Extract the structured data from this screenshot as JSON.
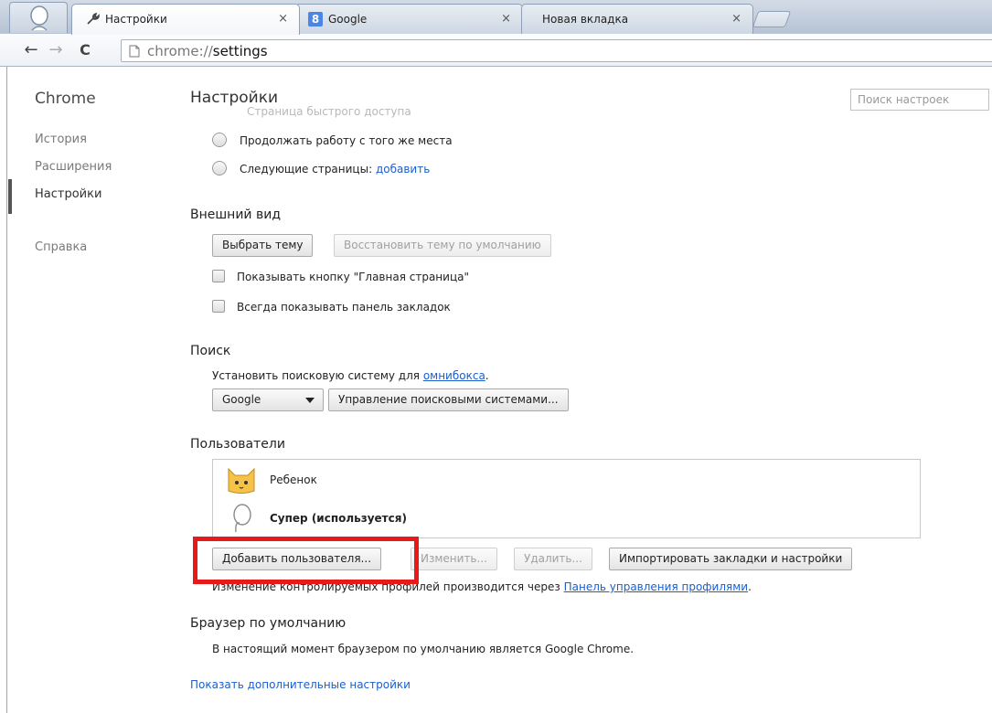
{
  "tabs": [
    {
      "title": "Настройки",
      "icon": "wrench-icon",
      "close": "×"
    },
    {
      "title": "Google",
      "icon": "google-icon",
      "icon_glyph": "8",
      "close": "×"
    },
    {
      "title": "Новая вкладка",
      "icon": "",
      "close": "×"
    }
  ],
  "toolbar": {
    "back": "←",
    "forward": "→",
    "reload": "C",
    "url_scheme": "chrome://",
    "url_host": "settings"
  },
  "sidebar": {
    "title": "Chrome",
    "items": [
      {
        "label": "История"
      },
      {
        "label": "Расширения"
      },
      {
        "label": "Настройки"
      },
      {
        "label": "Справка"
      }
    ]
  },
  "main": {
    "title": "Настройки",
    "ghost_text": "Страница быстрого доступа",
    "search_placeholder": "Поиск настроек",
    "startup": {
      "option1": "Продолжать работу с того же места",
      "option2": "Следующие страницы:",
      "option2_link": "добавить"
    },
    "appearance": {
      "title": "Внешний вид",
      "choose_theme": "Выбрать тему",
      "reset_theme": "Восстановить тему по умолчанию",
      "show_home": "Показывать кнопку \"Главная страница\"",
      "show_bookmarks": "Всегда показывать панель закладок"
    },
    "search": {
      "title": "Поиск",
      "description": "Установить поисковую систему для",
      "description_link": "омнибокса",
      "description_end": ".",
      "engine": "Google",
      "manage": "Управление поисковыми системами..."
    },
    "users": {
      "title": "Пользователи",
      "list": [
        {
          "name": "Ребенок",
          "avatar": "cat-avatar-icon"
        },
        {
          "name": "Супер (используется)",
          "avatar": "default-avatar-icon"
        }
      ],
      "add": "Добавить пользователя...",
      "edit": "Изменить...",
      "delete": "Удалить...",
      "import": "Импортировать закладки и настройки",
      "note": "Изменение контролируемых профилей производится через",
      "note_link": "Панель управления профилями",
      "note_end": "."
    },
    "default_browser": {
      "title": "Браузер по умолчанию",
      "text": "В настоящий момент браузером по умолчанию является Google Chrome."
    },
    "advanced_link": "Показать дополнительные настройки"
  },
  "colors": {
    "highlight": "#e81919",
    "link": "#1a5fd0"
  }
}
